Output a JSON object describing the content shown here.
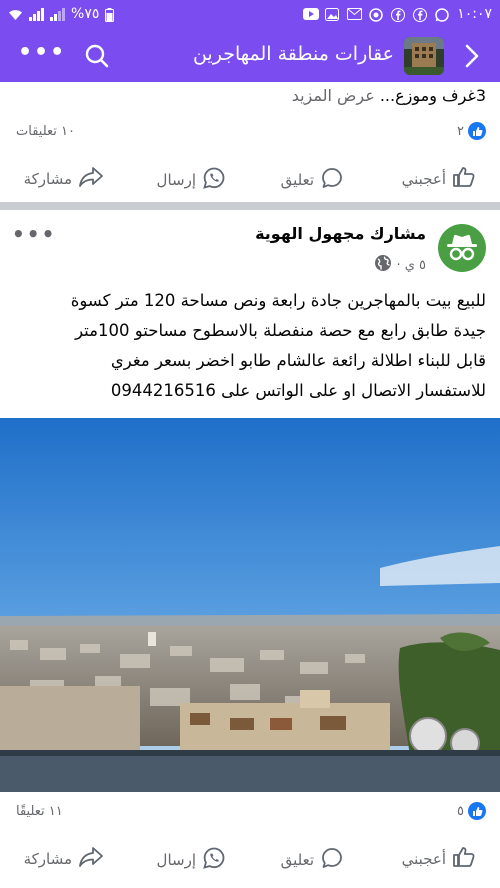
{
  "status_bar": {
    "time": "١٠:٠٧",
    "battery": "%٧٥",
    "icons": [
      "wifi-icon",
      "signal-icon",
      "battery-icon",
      "youtube-icon",
      "gallery-icon",
      "mail-icon",
      "vpn-icon",
      "facebook-icon",
      "facebook-icon",
      "whatsapp-icon"
    ]
  },
  "app_bar": {
    "title": "عقارات منطقة المهاجرين",
    "icons": [
      "back-icon",
      "search-icon",
      "more-icon"
    ]
  },
  "post1": {
    "snippet": "3غرف وموزع...",
    "see_more": "عرض المزيد",
    "likes_count": "٢",
    "comments": "١٠ تعليقات"
  },
  "actions": {
    "like": "أعجبني",
    "comment": "تعليق",
    "send": "إرسال",
    "share": "مشاركة"
  },
  "post2": {
    "author": "مشارك مجهول الهوية",
    "time": "٥ ي ·",
    "text_lines": [
      "للبيع بيت بالمهاجرين جادة رابعة ونص مساحة 120 متر كسوة",
      "جيدة طابق رابع مع حصة منفصلة بالاسطوح مساحتو 100متر",
      "قابل للبناء  اطلالة رائعة عالشام طابو اخضر  بسعر مغري",
      "للاستفسار الاتصال او على الواتس على 0944216516"
    ],
    "likes_count": "٥",
    "comments": "١١ تعليقًا"
  },
  "colors": {
    "brand": "#7b4df0",
    "like_blue": "#1877f2",
    "avatar_green": "#4a9e44",
    "muted": "#65676b"
  }
}
